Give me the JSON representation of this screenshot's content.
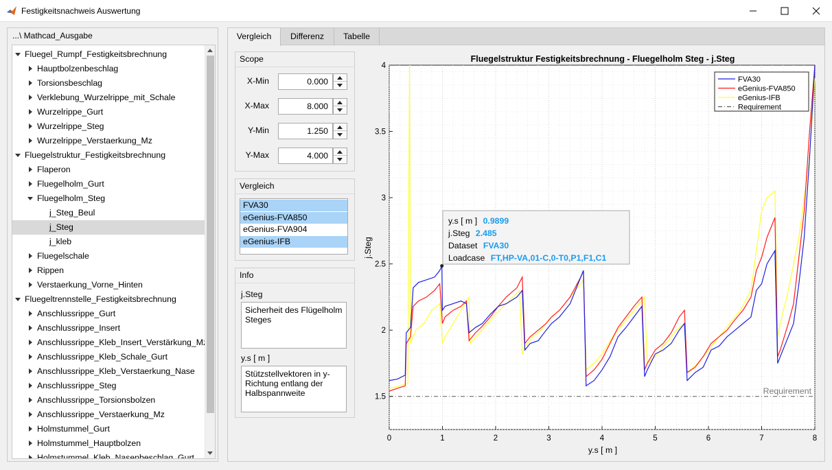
{
  "window": {
    "title": "Festigkeitsnachweis Auswertung",
    "icon": "matlab-icon"
  },
  "tree": {
    "header": "...\\ Mathcad_Ausgabe",
    "rows": [
      {
        "label": "Fluegel_Rumpf_Festigkeitsbrechnung",
        "level": 0,
        "state": "expanded"
      },
      {
        "label": "Hauptbolzenbeschlag",
        "level": 1,
        "state": "collapsed"
      },
      {
        "label": "Torsionsbeschlag",
        "level": 1,
        "state": "collapsed"
      },
      {
        "label": "Verklebung_Wurzelrippe_mit_Schale",
        "level": 1,
        "state": "collapsed"
      },
      {
        "label": "Wurzelrippe_Gurt",
        "level": 1,
        "state": "collapsed"
      },
      {
        "label": "Wurzelrippe_Steg",
        "level": 1,
        "state": "collapsed"
      },
      {
        "label": "Wurzelrippe_Verstaerkung_Mz",
        "level": 1,
        "state": "collapsed"
      },
      {
        "label": "Fluegelstruktur_Festigkeitsbrechnung",
        "level": 0,
        "state": "expanded"
      },
      {
        "label": "Flaperon",
        "level": 1,
        "state": "collapsed"
      },
      {
        "label": "Fluegelholm_Gurt",
        "level": 1,
        "state": "collapsed"
      },
      {
        "label": "Fluegelholm_Steg",
        "level": 1,
        "state": "expanded"
      },
      {
        "label": "j_Steg_Beul",
        "level": 2,
        "state": "leaf"
      },
      {
        "label": "j_Steg",
        "level": 2,
        "state": "leaf",
        "selected": true
      },
      {
        "label": "j_kleb",
        "level": 2,
        "state": "leaf"
      },
      {
        "label": "Fluegelschale",
        "level": 1,
        "state": "collapsed"
      },
      {
        "label": "Rippen",
        "level": 1,
        "state": "collapsed"
      },
      {
        "label": "Verstaerkung_Vorne_Hinten",
        "level": 1,
        "state": "collapsed"
      },
      {
        "label": "Fluegeltrennstelle_Festigkeitsbrechnung",
        "level": 0,
        "state": "expanded"
      },
      {
        "label": "Anschlussrippe_Gurt",
        "level": 1,
        "state": "collapsed"
      },
      {
        "label": "Anschlussrippe_Insert",
        "level": 1,
        "state": "collapsed"
      },
      {
        "label": "Anschlussrippe_Kleb_Insert_Verstärkung_Mz",
        "level": 1,
        "state": "collapsed"
      },
      {
        "label": "Anschlussrippe_Kleb_Schale_Gurt",
        "level": 1,
        "state": "collapsed"
      },
      {
        "label": "Anschlussrippe_Kleb_Verstaerkung_Nase",
        "level": 1,
        "state": "collapsed"
      },
      {
        "label": "Anschlussrippe_Steg",
        "level": 1,
        "state": "collapsed"
      },
      {
        "label": "Anschlussrippe_Torsionsbolzen",
        "level": 1,
        "state": "collapsed"
      },
      {
        "label": "Anschlussrippe_Verstaerkung_Mz",
        "level": 1,
        "state": "collapsed"
      },
      {
        "label": "Holmstummel_Gurt",
        "level": 1,
        "state": "collapsed"
      },
      {
        "label": "Holmstummel_Hauptbolzen",
        "level": 1,
        "state": "collapsed"
      },
      {
        "label": "Holmstummel_Kleb_Nasenbeschlag_Gurt",
        "level": 1,
        "state": "collapsed"
      }
    ]
  },
  "tabs": [
    {
      "label": "Vergleich",
      "active": true
    },
    {
      "label": "Differenz",
      "active": false
    },
    {
      "label": "Tabelle",
      "active": false
    }
  ],
  "scope": {
    "title": "Scope",
    "fields": [
      {
        "label": "X-Min",
        "value": "0.000"
      },
      {
        "label": "X-Max",
        "value": "8.000"
      },
      {
        "label": "Y-Min",
        "value": "1.250"
      },
      {
        "label": "Y-Max",
        "value": "4.000"
      }
    ]
  },
  "vergleich": {
    "title": "Vergleich",
    "items": [
      {
        "label": "FVA30",
        "selected": true
      },
      {
        "label": "eGenius-FVA850",
        "selected": true
      },
      {
        "label": "eGenius-FVA904",
        "selected": false
      },
      {
        "label": "eGenius-IFB",
        "selected": true
      }
    ]
  },
  "info": {
    "title": "Info",
    "var1_label": "j.Steg",
    "var1_desc": "Sicherheit des Flügelholm Steges",
    "var2_label": "y.s [ m ]",
    "var2_desc": "Stützstellvektoren in y-Richtung entlang der Halbspannweite"
  },
  "datatip": {
    "x_label": "y.s [ m ]",
    "x_value": "0.9899",
    "y_label": "j.Steg",
    "y_value": "2.485",
    "dataset_label": "Dataset",
    "dataset_value": "FVA30",
    "loadcase_label": "Loadcase",
    "loadcase_value": "FT,HP-VA,01-C,0-T0,P1,F1,C1"
  },
  "colors": {
    "fva30": "#1f1fe0",
    "fva850": "#ff1a1a",
    "ifb": "#ffff33",
    "requirement": "#595959",
    "datatip": "#1a9cf0"
  },
  "chart_data": {
    "type": "line",
    "title": "Fluegelstruktur Festigkeitsbrechnung - Fluegelholm Steg - j.Steg",
    "xlabel": "y.s [ m ]",
    "ylabel": "j.Steg",
    "xlim": [
      0,
      8
    ],
    "ylim": [
      1.25,
      4
    ],
    "xticks": [
      "0",
      "1",
      "2",
      "3",
      "4",
      "5",
      "6",
      "7",
      "8"
    ],
    "yticks": [
      "1.5",
      "2",
      "2.5",
      "3",
      "3.5",
      "4"
    ],
    "grid": "major+minor dotted",
    "legend_position": "top-right",
    "requirement": {
      "name": "Requirement",
      "value": 1.5,
      "label": "Requirement"
    },
    "series": [
      {
        "name": "FVA30",
        "color": "#1f1fe0",
        "x": [
          0,
          0.15,
          0.3,
          0.32,
          0.4,
          0.45,
          0.55,
          0.7,
          0.85,
          0.95,
          0.99,
          1.0,
          1.05,
          1.2,
          1.35,
          1.45,
          1.5,
          1.62,
          1.75,
          1.9,
          2.05,
          2.2,
          2.4,
          2.5,
          2.55,
          2.65,
          2.8,
          2.95,
          3.05,
          3.2,
          3.4,
          3.6,
          3.65,
          3.7,
          3.85,
          4.0,
          4.15,
          4.3,
          4.45,
          4.6,
          4.75,
          4.8,
          4.85,
          5.0,
          5.15,
          5.3,
          5.45,
          5.55,
          5.6,
          5.75,
          5.9,
          6.05,
          6.2,
          6.35,
          6.5,
          6.65,
          6.8,
          6.9,
          7.0,
          7.1,
          7.25,
          7.3,
          7.35,
          7.5,
          7.6,
          7.7,
          7.8,
          7.9,
          8.0
        ],
        "y": [
          1.62,
          1.63,
          1.66,
          1.98,
          2.02,
          2.32,
          2.36,
          2.38,
          2.4,
          2.45,
          2.485,
          2.15,
          2.18,
          2.2,
          2.22,
          2.2,
          1.98,
          2.02,
          2.05,
          2.12,
          2.18,
          2.2,
          2.25,
          2.3,
          1.85,
          1.9,
          1.92,
          2.0,
          2.05,
          2.1,
          2.2,
          2.4,
          2.45,
          1.58,
          1.62,
          1.7,
          1.8,
          1.95,
          2.02,
          2.1,
          2.18,
          1.65,
          1.7,
          1.82,
          1.85,
          1.9,
          2.0,
          2.05,
          1.62,
          1.68,
          1.72,
          1.85,
          1.88,
          1.95,
          2.0,
          2.05,
          2.1,
          2.3,
          2.35,
          2.5,
          2.6,
          1.75,
          1.8,
          1.95,
          2.05,
          2.35,
          2.7,
          3.3,
          4.0
        ]
      },
      {
        "name": "eGenius-FVA850",
        "color": "#ff1a1a",
        "x": [
          0,
          0.15,
          0.3,
          0.32,
          0.4,
          0.45,
          0.55,
          0.7,
          0.85,
          0.95,
          1.0,
          1.05,
          1.2,
          1.35,
          1.45,
          1.5,
          1.62,
          1.75,
          1.9,
          2.05,
          2.2,
          2.4,
          2.5,
          2.55,
          2.65,
          2.8,
          2.95,
          3.05,
          3.2,
          3.4,
          3.6,
          3.65,
          3.7,
          3.85,
          4.0,
          4.15,
          4.3,
          4.45,
          4.6,
          4.75,
          4.8,
          4.85,
          5.0,
          5.15,
          5.3,
          5.45,
          5.55,
          5.6,
          5.75,
          5.9,
          6.05,
          6.2,
          6.35,
          6.5,
          6.65,
          6.8,
          6.9,
          7.0,
          7.1,
          7.25,
          7.3,
          7.35,
          7.5,
          7.6,
          7.7,
          7.8,
          7.9,
          8.0
        ],
        "y": [
          1.54,
          1.56,
          1.58,
          1.9,
          1.95,
          2.18,
          2.22,
          2.25,
          2.3,
          2.35,
          2.05,
          2.1,
          2.15,
          2.18,
          2.22,
          1.92,
          1.98,
          2.03,
          2.1,
          2.18,
          2.25,
          2.32,
          2.4,
          1.9,
          1.95,
          2.0,
          2.05,
          2.1,
          2.15,
          2.25,
          2.4,
          2.45,
          1.65,
          1.7,
          1.78,
          1.9,
          2.02,
          2.1,
          2.18,
          2.25,
          1.7,
          1.75,
          1.85,
          1.9,
          1.98,
          2.1,
          2.15,
          1.68,
          1.72,
          1.8,
          1.9,
          1.95,
          2.0,
          2.08,
          2.15,
          2.25,
          2.45,
          2.55,
          2.7,
          2.85,
          1.8,
          1.85,
          2.05,
          2.2,
          2.55,
          2.9,
          3.5,
          4.0
        ]
      },
      {
        "name": "eGenius-IFB",
        "color": "#ffff33",
        "x": [
          0,
          0.2,
          0.35,
          0.38,
          0.4,
          0.5,
          0.65,
          0.8,
          0.95,
          1.0,
          1.05,
          1.2,
          1.35,
          1.5,
          1.52,
          1.7,
          1.85,
          2.0,
          2.2,
          2.45,
          2.5,
          2.55,
          2.7,
          2.85,
          3.0,
          3.2,
          3.4,
          3.6,
          3.65,
          3.7,
          3.85,
          4.0,
          4.2,
          4.4,
          4.6,
          4.8,
          4.85,
          5.0,
          5.2,
          5.4,
          5.55,
          5.6,
          5.8,
          6.0,
          6.2,
          6.4,
          6.6,
          6.8,
          6.9,
          7.0,
          7.1,
          7.25,
          7.3,
          7.35,
          7.5,
          7.7,
          7.9,
          8.0
        ],
        "y": [
          1.56,
          1.58,
          1.6,
          4.0,
          1.9,
          2.0,
          2.05,
          2.15,
          2.2,
          1.9,
          1.95,
          2.05,
          2.15,
          2.25,
          1.9,
          1.98,
          2.05,
          2.12,
          2.2,
          2.3,
          1.82,
          1.88,
          1.95,
          2.0,
          2.08,
          2.15,
          2.25,
          2.35,
          2.38,
          1.7,
          1.75,
          1.82,
          1.95,
          2.05,
          2.15,
          2.25,
          1.75,
          1.8,
          1.9,
          2.0,
          2.05,
          1.68,
          1.75,
          1.85,
          1.95,
          2.05,
          2.15,
          2.3,
          2.6,
          2.9,
          3.0,
          3.05,
          1.95,
          2.05,
          2.3,
          2.7,
          3.3,
          3.9
        ]
      }
    ]
  }
}
